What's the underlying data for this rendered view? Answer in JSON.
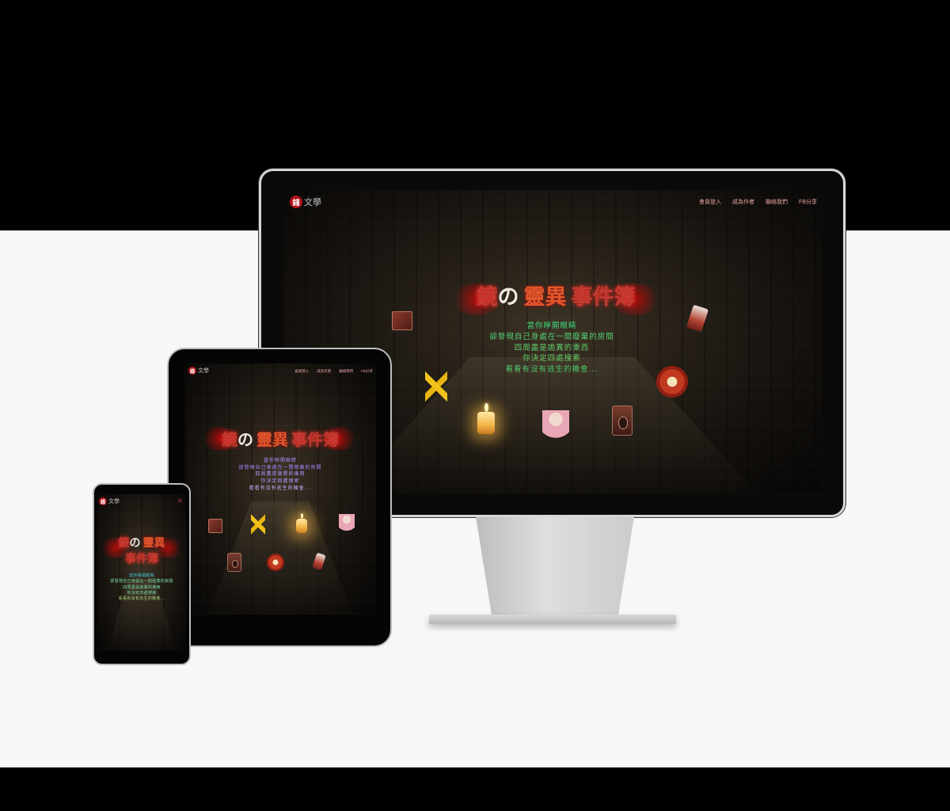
{
  "brand": {
    "badge": "錢",
    "name": "文學"
  },
  "nav": [
    "會員登入",
    "成為作者",
    "聯絡我們",
    "FB分享"
  ],
  "title": {
    "part1": "鏡",
    "part2": "の",
    "part3": "靈異",
    "part4": "事件簿"
  },
  "intro_lines": [
    "當你睜開眼睛",
    "卻發現自己身處在一間廢棄的房間",
    "四周盡是詭異的東西",
    "你決定四處搜索",
    "看看有沒有逃生的機會..."
  ],
  "menu_icon": "hamburger-icon",
  "colors": {
    "accent_red": "#b3121a",
    "intro_green": "#41d97b",
    "intro_purple": "#a68bff"
  },
  "devices": [
    "desktop-monitor",
    "tablet",
    "phone"
  ]
}
